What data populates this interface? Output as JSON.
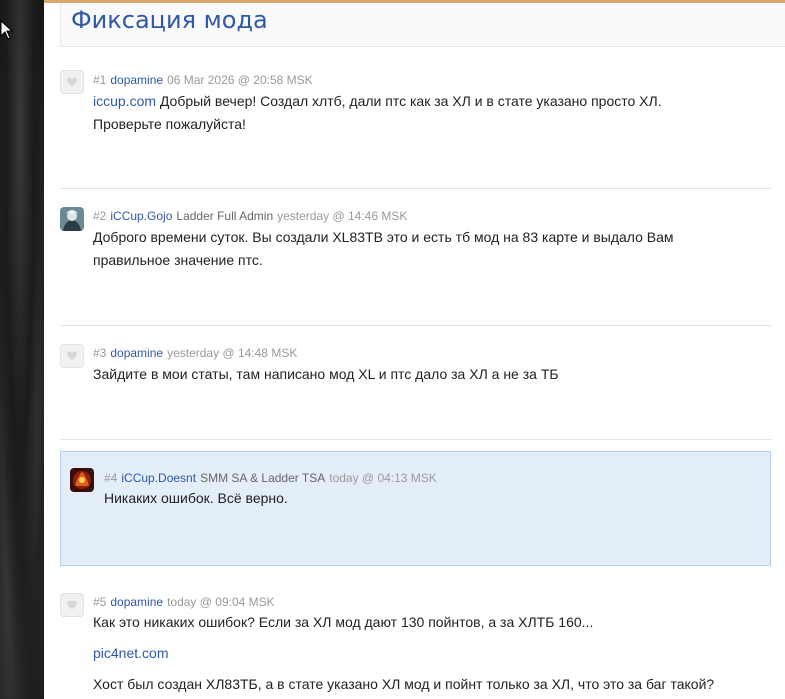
{
  "page": {
    "title": "Фиксация мода"
  },
  "posts": [
    {
      "num": "#1",
      "user": "dopamine",
      "role": "",
      "date": "06 Mar 2026 @ 20:58 MSK",
      "link": "iccup.com",
      "text": "Добрый вечер! Создал хлтб, дали птс как за ХЛ и в стате указано просто ХЛ.",
      "text2": "Проверьте пожалуйста!"
    },
    {
      "num": "#2",
      "user": "iCCup.Gojo",
      "role": "Ladder Full Admin",
      "date": "yesterday @ 14:46 MSK",
      "text": "Доброго времени суток. Вы создали XL83TB это и есть тб мод на 83 карте и выдало Вам",
      "text2": "правильное значение птс."
    },
    {
      "num": "#3",
      "user": "dopamine",
      "role": "",
      "date": "yesterday @ 14:48 MSK",
      "text": "Зайдите в мои статы, там написано мод XL и птс дало за ХЛ а не за ТБ"
    },
    {
      "num": "#4",
      "user": "iCCup.Doesnt",
      "role": "SMM SA & Ladder TSA",
      "date": "today @ 04:13 MSK",
      "text": "Никаких ошибок. Всё верно."
    },
    {
      "num": "#5",
      "user": "dopamine",
      "role": "",
      "date": "today @ 09:04 MSK",
      "text": "Как это никаких ошибок? Если за ХЛ мод дают 130 пойнтов, а за ХЛТБ 160...",
      "link": "pic4net.com",
      "text2": "Хост был создан ХЛ83ТБ, а в стате указано ХЛ мод и пойнт только за ХЛ, что это за баг такой?"
    }
  ],
  "colors": {
    "title": "#2f58a8",
    "link": "#2f58a8",
    "highlight_bg": "#e3eef9",
    "top_accent": "#d9a86c"
  }
}
